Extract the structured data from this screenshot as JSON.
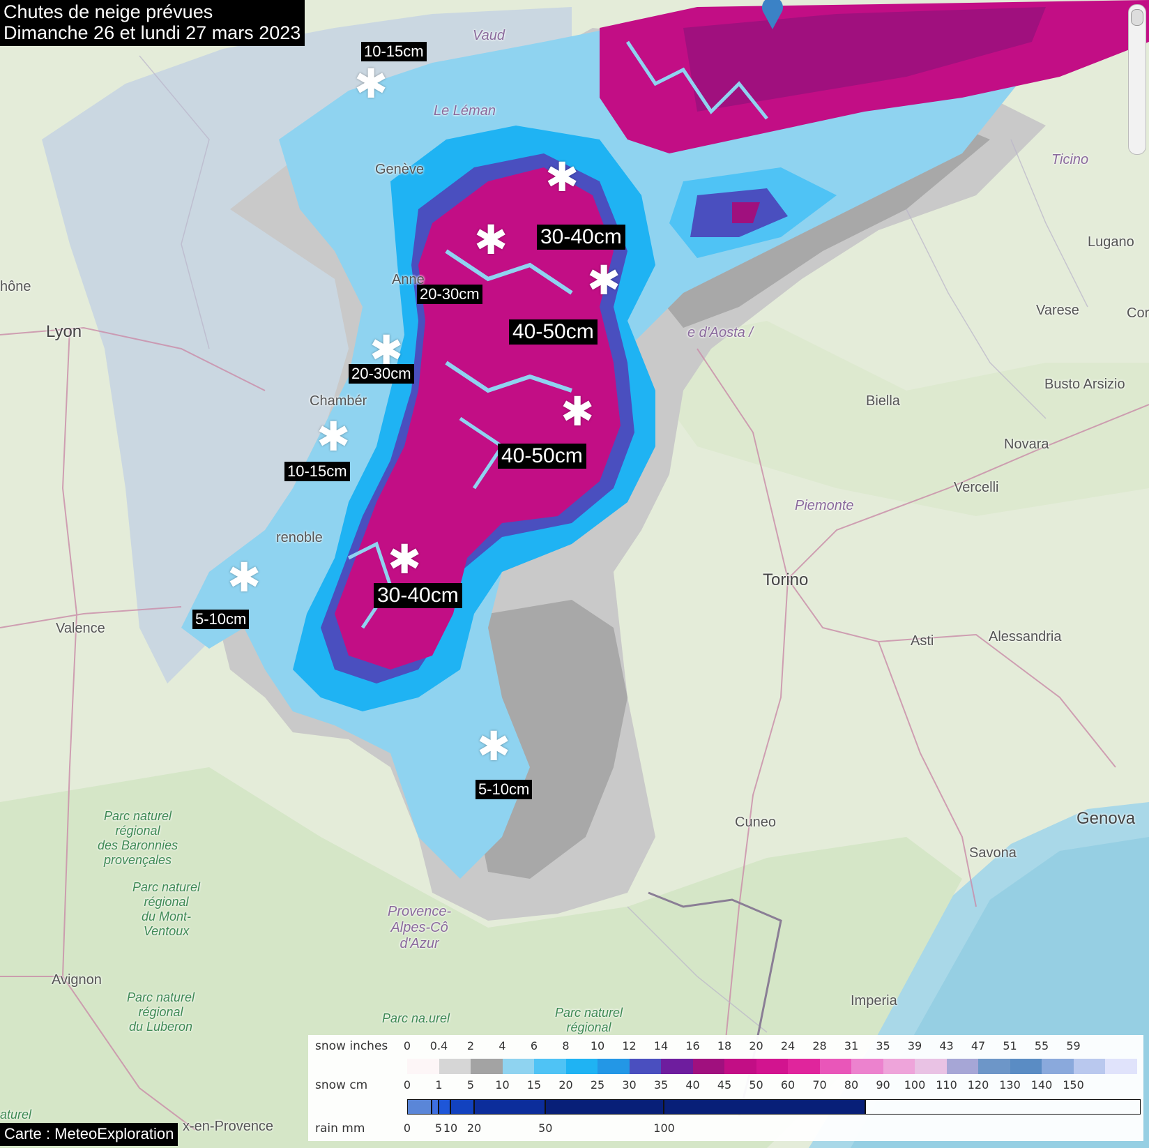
{
  "title": {
    "line1": "Chutes de neige prévues",
    "line2": "Dimanche 26 et lundi 27 mars 2023"
  },
  "snow_labels": [
    {
      "text": "10-15cm",
      "size": "small"
    },
    {
      "text": "30-40cm",
      "size": "large"
    },
    {
      "text": "20-30cm",
      "size": "small"
    },
    {
      "text": "40-50cm",
      "size": "large"
    },
    {
      "text": "20-30cm",
      "size": "small"
    },
    {
      "text": "40-50cm",
      "size": "large"
    },
    {
      "text": "10-15cm",
      "size": "small"
    },
    {
      "text": "30-40cm",
      "size": "large"
    },
    {
      "text": "5-10cm",
      "size": "small"
    },
    {
      "text": "5-10cm",
      "size": "small"
    }
  ],
  "places": {
    "vaud": "Vaud",
    "le_leman": "Le Léman",
    "geneve": "Genève",
    "annecy": "Anne",
    "lyon": "Lyon",
    "rhone": "hône",
    "chambery": "Chambér",
    "grenoble": "renoble",
    "valence": "Valence",
    "ticino": "Ticino",
    "lugano": "Lugano",
    "varese": "Varese",
    "como": "Cor",
    "aosta": "e d'Aosta /",
    "busto": "Busto Arsizio",
    "biella": "Biella",
    "novara": "Novara",
    "vercelli": "Vercelli",
    "piemonte": "Piemonte",
    "torino": "Torino",
    "asti": "Asti",
    "alessandria": "Alessandria",
    "cuneo": "Cuneo",
    "genova": "Genova",
    "savona": "Savona",
    "imperia": "Imperia",
    "avignon": "Avignon",
    "aix": "x-en-Provence",
    "provence": "Provence-\nAlpes-Cô\nd'Azur",
    "baronnies": "Parc naturel\nrégional\ndes Baronnies\nprovençales",
    "mont_ventoux": "Parc naturel\nrégional\ndu Mont-\nVentoux",
    "luberon": "Parc naturel\nrégional\ndu Luberon",
    "parc_bottom1": "Parc na.urel",
    "parc_bottom2": "Parc naturel\nrégional",
    "parc_left": "aturel"
  },
  "legend": {
    "snow_inches_label": "snow inches",
    "snow_cm_label": "snow cm",
    "rain_mm_label": "rain mm",
    "inch_ticks": [
      "0",
      "0.4",
      "2",
      "4",
      "6",
      "8",
      "10",
      "12",
      "14",
      "16",
      "18",
      "20",
      "24",
      "28",
      "31",
      "35",
      "39",
      "43",
      "47",
      "51",
      "55",
      "59"
    ],
    "cm_ticks": [
      "0",
      "1",
      "5",
      "10",
      "15",
      "20",
      "25",
      "30",
      "35",
      "40",
      "45",
      "50",
      "60",
      "70",
      "80",
      "90",
      "100",
      "110",
      "120",
      "130",
      "140",
      "150"
    ],
    "rain_ticks": [
      "0",
      "5",
      "10",
      "20",
      "50",
      "100"
    ],
    "colors": [
      "#fdf6f7",
      "#d6d6d6",
      "#a3a3a3",
      "#8fd3f0",
      "#4fc3f5",
      "#1fb3f3",
      "#2397e6",
      "#4a4fbf",
      "#6e1d9e",
      "#a0107e",
      "#c20e85",
      "#d2148f",
      "#e0259c",
      "#e956b9",
      "#ec82ce",
      "#eea4da",
      "#e9c2e4",
      "#a6a6d6",
      "#6d96c8",
      "#5a8cc4",
      "#8aa9dc",
      "#b9c8ee",
      "#e0e3fb"
    ],
    "rain_colors": [
      "#5a86d8",
      "#3e6fe0",
      "#1e56d8",
      "#1242bf",
      "#0c2d9b",
      "#081f78"
    ]
  },
  "credit": "Carte : MeteoExploration"
}
